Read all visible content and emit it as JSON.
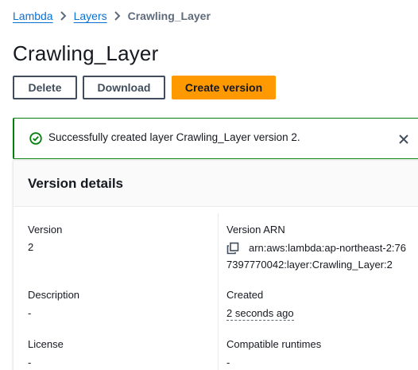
{
  "breadcrumb": {
    "items": [
      "Lambda",
      "Layers"
    ],
    "current": "Crawling_Layer"
  },
  "header": {
    "title": "Crawling_Layer"
  },
  "actions": {
    "delete_label": "Delete",
    "download_label": "Download",
    "create_version_label": "Create version"
  },
  "flash": {
    "type": "success",
    "message": "Successfully created layer Crawling_Layer version 2."
  },
  "panel": {
    "title": "Version details",
    "fields": {
      "version_label": "Version",
      "version_value": "2",
      "arn_label": "Version ARN",
      "arn_value": "arn:aws:lambda:ap-northeast-2:767397770042:layer:Crawling_Layer:2",
      "description_label": "Description",
      "description_value": "-",
      "created_label": "Created",
      "created_value": "2 seconds ago",
      "license_label": "License",
      "license_value": "-",
      "runtimes_label": "Compatible runtimes",
      "runtimes_value": "-"
    }
  },
  "colors": {
    "link": "#0972d3",
    "primary_button": "#ff9900",
    "success": "#037f0c",
    "text": "#16191f"
  }
}
